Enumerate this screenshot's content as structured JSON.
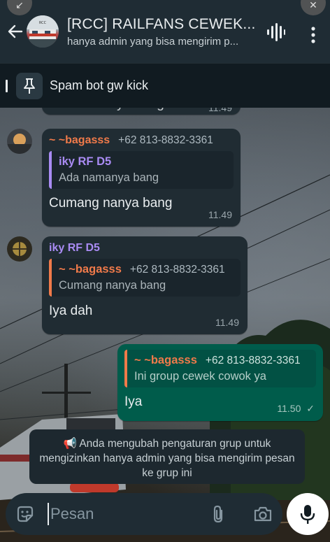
{
  "header": {
    "title": "[RCC] RAILFANS CEWEK...",
    "subtitle": "hanya admin yang bisa mengirim p..."
  },
  "pinned": {
    "text": "Spam bot gw kick"
  },
  "partial_message": {
    "text": "Ada namanya bang",
    "time": "11.49"
  },
  "messages": [
    {
      "sender": "~ ~bagasss",
      "phone": "+62 813-8832-3361",
      "sender_color": "#f07a4a",
      "quote_name": "iky RF D5",
      "quote_text": "Ada namanya bang",
      "quote_color": "#a98bf3",
      "text": "Cumang nanya bang",
      "time": "11.49"
    },
    {
      "sender": "iky RF D5",
      "sender_color": "#a98bf3",
      "quote_name": "~ ~bagasss",
      "quote_phone": "+62 813-8832-3361",
      "quote_text": "Cumang nanya bang",
      "quote_color": "#f07a4a",
      "text": "Iya dah",
      "time": "11.49"
    },
    {
      "quote_name": "~ ~bagasss",
      "quote_phone": "+62 813-8832-3361",
      "quote_text": "Ini group cewek cowok ya",
      "quote_color": "#f07a4a",
      "text": "Iya",
      "time": "11.50",
      "status": "✓"
    }
  ],
  "system_notice": {
    "icon": "megaphone-icon",
    "text": "Anda mengubah pengaturan grup untuk mengizinkan hanya admin yang bisa mengirim pesan ke grup ini"
  },
  "composer": {
    "placeholder": "Pesan"
  },
  "colors": {
    "header_bg": "#1f2c34",
    "incoming_bubble": "#202c33",
    "outgoing_bubble": "#005c4b"
  }
}
